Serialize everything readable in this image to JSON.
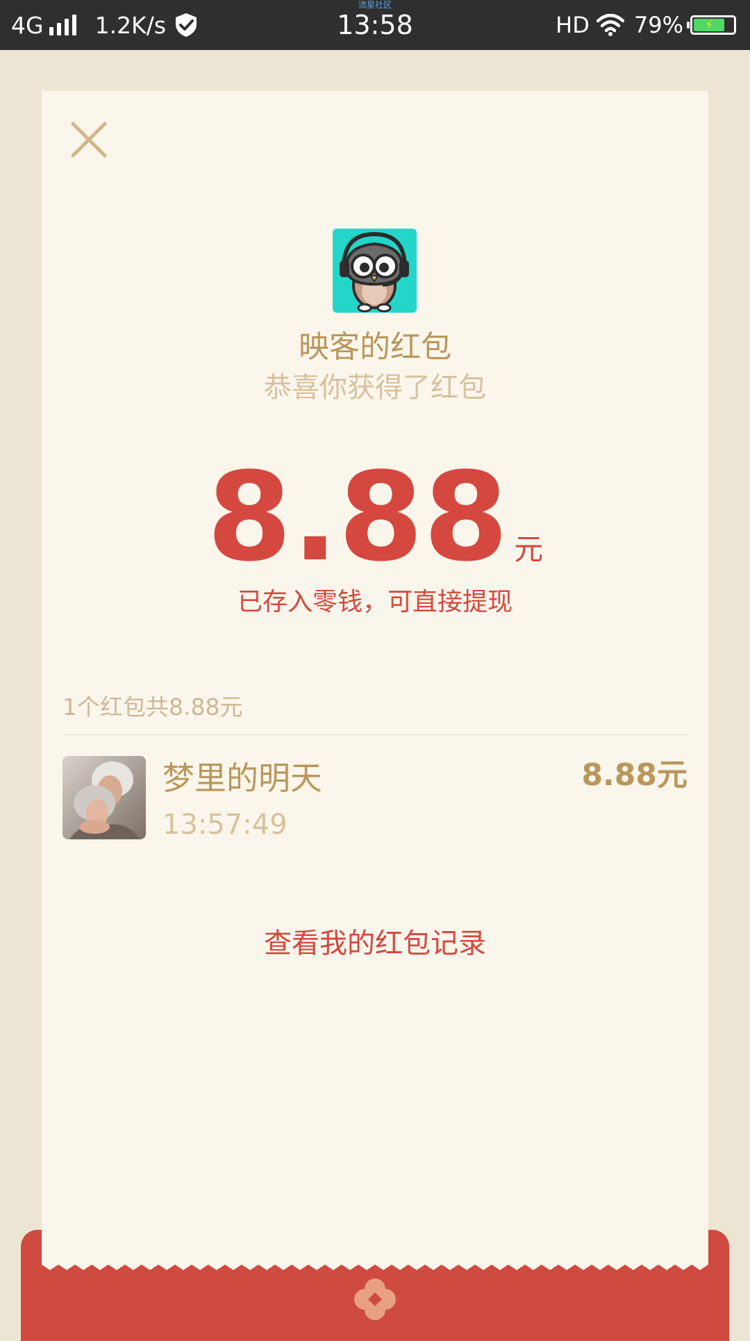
{
  "status_bar": {
    "overlay_label": "流星社区",
    "network": "4G",
    "speed": "1.2K/s",
    "time": "13:58",
    "hd": "HD",
    "battery_percent": "79%",
    "battery_level": 0.79
  },
  "close_icon": "close-icon",
  "app_logo_icon": "owl-headphones-icon",
  "title": "映客的红包",
  "subtitle": "恭喜你获得了红包",
  "amount": {
    "value": "8.88",
    "unit": "元",
    "note": "已存入零钱，可直接提现"
  },
  "summary": "1个红包共8.88元",
  "records": [
    {
      "name": "梦里的明天",
      "time": "13:57:49",
      "amount": "8.88元"
    }
  ],
  "history_link": "查看我的红包记录",
  "colors": {
    "background": "#ede5d4",
    "card": "#faf6ec",
    "gold": "#b9975c",
    "gold_light": "#d7c19c",
    "red": "#d5483f",
    "envelope": "#cf4a3f",
    "status_bar": "#2f2f2f"
  }
}
